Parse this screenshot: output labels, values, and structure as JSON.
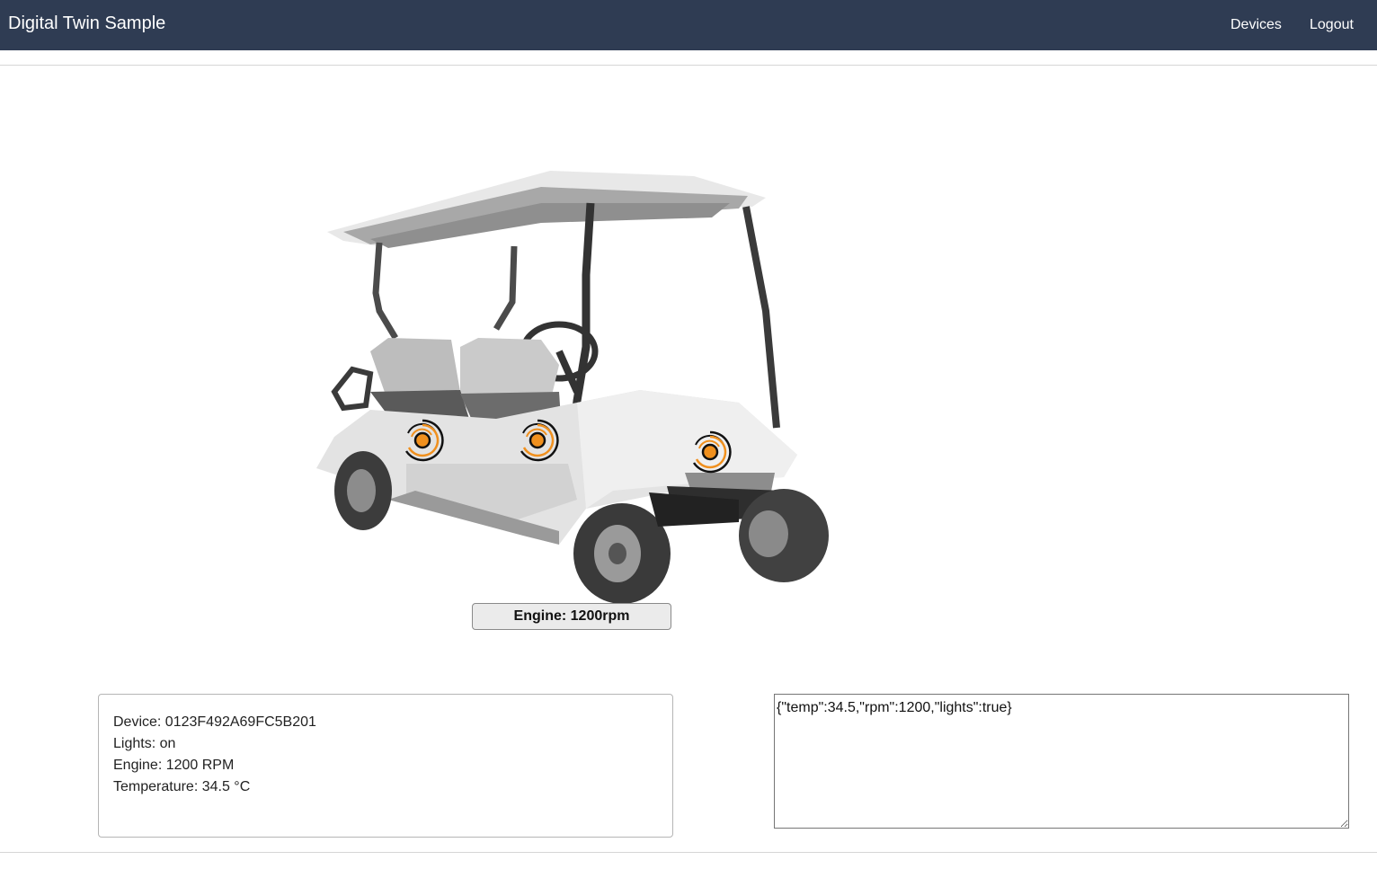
{
  "navbar": {
    "brand": "Digital Twin Sample",
    "links": [
      {
        "label": "Devices"
      },
      {
        "label": "Logout"
      }
    ],
    "background_color": "#2f3c53"
  },
  "twin": {
    "image": "golf-cart",
    "hotspots": [
      {
        "name": "rear-seat-hotspot",
        "icon": "target-icon"
      },
      {
        "name": "front-seat-hotspot",
        "icon": "target-icon"
      },
      {
        "name": "hood-hotspot",
        "icon": "target-icon"
      }
    ],
    "hotspot_color": "#f0901e",
    "status_label": "Engine: 1200rpm"
  },
  "info": {
    "device": "Device: 0123F492A69FC5B201",
    "lights": "Lights: on",
    "engine": "Engine: 1200 RPM",
    "temperature": "Temperature: 34.5 °C"
  },
  "payload": {
    "value": "{\"temp\":34.5,\"rpm\":1200,\"lights\":true}"
  }
}
